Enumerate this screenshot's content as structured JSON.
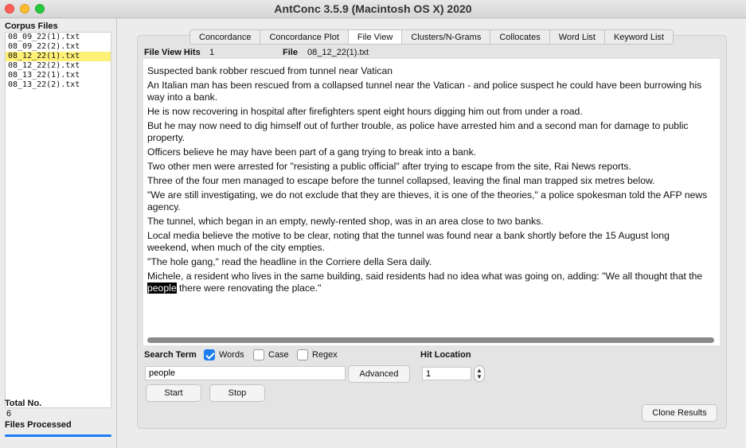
{
  "window": {
    "title": "AntConc 3.5.9 (Macintosh OS X) 2020"
  },
  "sidebar": {
    "header": "Corpus Files",
    "files": [
      {
        "name": "08_09_22(1).txt",
        "selected": false
      },
      {
        "name": "08_09_22(2).txt",
        "selected": false
      },
      {
        "name": "08_12_22(1).txt",
        "selected": true
      },
      {
        "name": "08_12_22(2).txt",
        "selected": false
      },
      {
        "name": "08_13_22(1).txt",
        "selected": false
      },
      {
        "name": "08_13_22(2).txt",
        "selected": false
      }
    ],
    "total_label": "Total No.",
    "total_value": "6",
    "processed_label": "Files Processed",
    "progress": 1.0
  },
  "tabs": [
    {
      "label": "Concordance",
      "active": false
    },
    {
      "label": "Concordance Plot",
      "active": false
    },
    {
      "label": "File View",
      "active": true
    },
    {
      "label": "Clusters/N-Grams",
      "active": false
    },
    {
      "label": "Collocates",
      "active": false
    },
    {
      "label": "Word List",
      "active": false
    },
    {
      "label": "Keyword List",
      "active": false
    }
  ],
  "fileview": {
    "hits_label": "File View Hits",
    "hits_value": "1",
    "file_label": "File",
    "file_value": "08_12_22(1).txt",
    "paragraphs": [
      "Suspected bank robber rescued from tunnel near Vatican",
      "An Italian man has been rescued from a collapsed tunnel near the Vatican - and police suspect he could have been burrowing his way into a bank.",
      "He is now recovering in hospital after firefighters spent eight hours digging him out from under a road.",
      "But he may now need to dig himself out of further trouble, as police have arrested him and a second man for damage to public property.",
      "Officers believe he may have been part of a gang trying to break into a bank.",
      "Two other men were arrested for \"resisting a public official\" after trying to escape from the site, Rai News reports.",
      "Three of the four men managed to escape before the tunnel collapsed, leaving the final man trapped six metres below.",
      "\"We are still investigating, we do not exclude that they are thieves, it is one of the theories,\" a police spokesman told the AFP news agency.",
      "The tunnel, which began in an empty, newly-rented shop, was in an area close to two banks.",
      "Local media believe the motive to be clear, noting that the tunnel was found near a bank shortly before the 15 August long weekend, when much of the city empties.",
      "\"The hole gang,\" read the headline in the Corriere della Sera daily."
    ],
    "last_paragraph": {
      "before": "Michele, a resident who lives in the same building, said residents had no idea what was going on, adding: \"We all thought that the ",
      "highlight": "people",
      "after": " there were renovating the place.\""
    }
  },
  "search": {
    "label": "Search Term",
    "words_label": "Words",
    "words_checked": true,
    "case_label": "Case",
    "case_checked": false,
    "regex_label": "Regex",
    "regex_checked": false,
    "value": "people",
    "advanced_label": "Advanced",
    "start_label": "Start",
    "stop_label": "Stop"
  },
  "hit_location": {
    "label": "Hit Location",
    "value": "1"
  },
  "clone_label": "Clone Results",
  "icons": [
    "close-icon",
    "minimize-icon",
    "maximize-icon",
    "checkmark-icon",
    "stepper-icon"
  ]
}
